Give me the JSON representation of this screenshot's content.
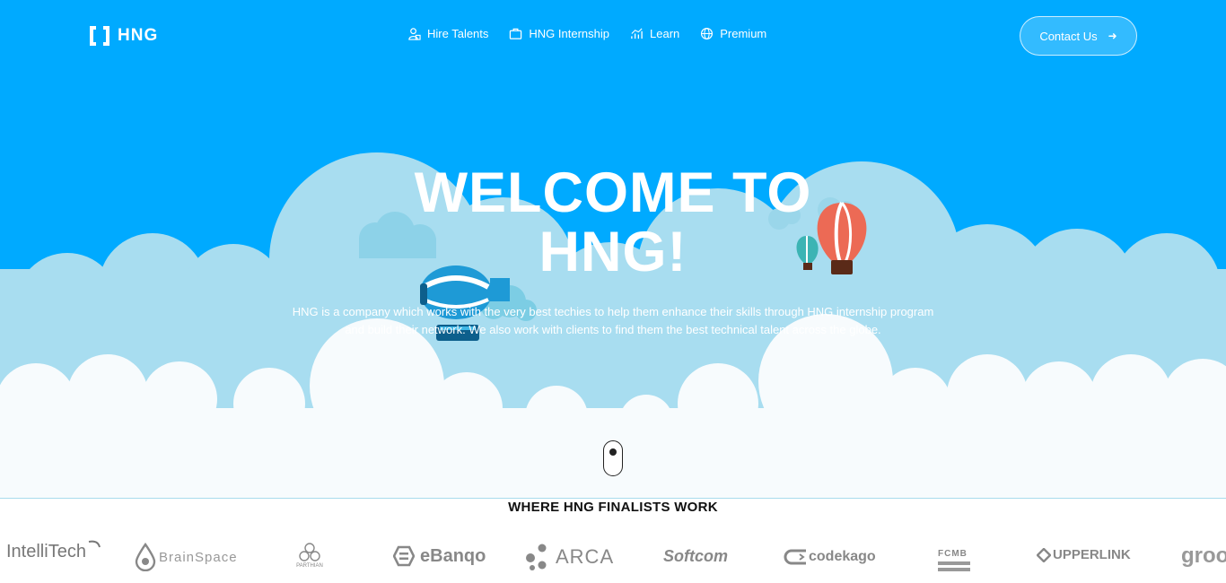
{
  "brand": {
    "name": "HNG"
  },
  "nav": {
    "items": [
      {
        "label": "Hire Talents",
        "icon": "user-icon"
      },
      {
        "label": "HNG Internship",
        "icon": "briefcase-icon"
      },
      {
        "label": "Learn",
        "icon": "chart-icon"
      },
      {
        "label": "Premium",
        "icon": "globe-icon"
      }
    ],
    "contact_label": "Contact Us"
  },
  "hero": {
    "title_line1": "WELCOME TO",
    "title_line2": "HNG!",
    "description": "HNG is a company which works with the very best techies to help them enhance their skills through HNG internship program and build their network. We also work with clients to find them the best technical talent across the globe."
  },
  "partners": {
    "title": "WHERE HNG FINALISTS WORK",
    "logos": [
      "IntelliTech",
      "BrainSpace",
      "PARTHIAN",
      "eBanqo",
      "ARCA",
      "Softcom",
      "codekago",
      "FCMB",
      "UPPERLINK",
      "groove"
    ]
  },
  "colors": {
    "sky": "#00aaff",
    "cloud_back": "#a8ddf0",
    "cloud_front": "#f7fbfd",
    "text_dark": "#111111"
  }
}
